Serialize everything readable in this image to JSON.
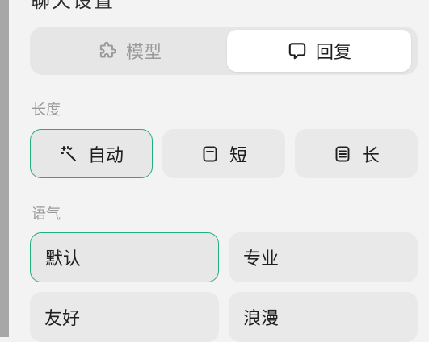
{
  "header": {
    "title": "聊天设置"
  },
  "mode_tabs": [
    {
      "label": "模型",
      "icon": "puzzle-icon",
      "selected": false
    },
    {
      "label": "回复",
      "icon": "chat-bubble-icon",
      "selected": true
    }
  ],
  "length": {
    "label": "长度",
    "options": [
      {
        "label": "自动",
        "icon": "magic-wand-icon",
        "selected": true
      },
      {
        "label": "短",
        "icon": "short-doc-icon",
        "selected": false
      },
      {
        "label": "长",
        "icon": "long-doc-icon",
        "selected": false
      }
    ]
  },
  "tone": {
    "label": "语气",
    "options": [
      {
        "label": "默认",
        "selected": true
      },
      {
        "label": "专业",
        "selected": false
      },
      {
        "label": "友好",
        "selected": false
      },
      {
        "label": "浪漫",
        "selected": false
      }
    ]
  },
  "colors": {
    "accent": "#21b07a",
    "selected_tab_bg": "#ffffff",
    "option_bg": "#e9e9e9"
  }
}
